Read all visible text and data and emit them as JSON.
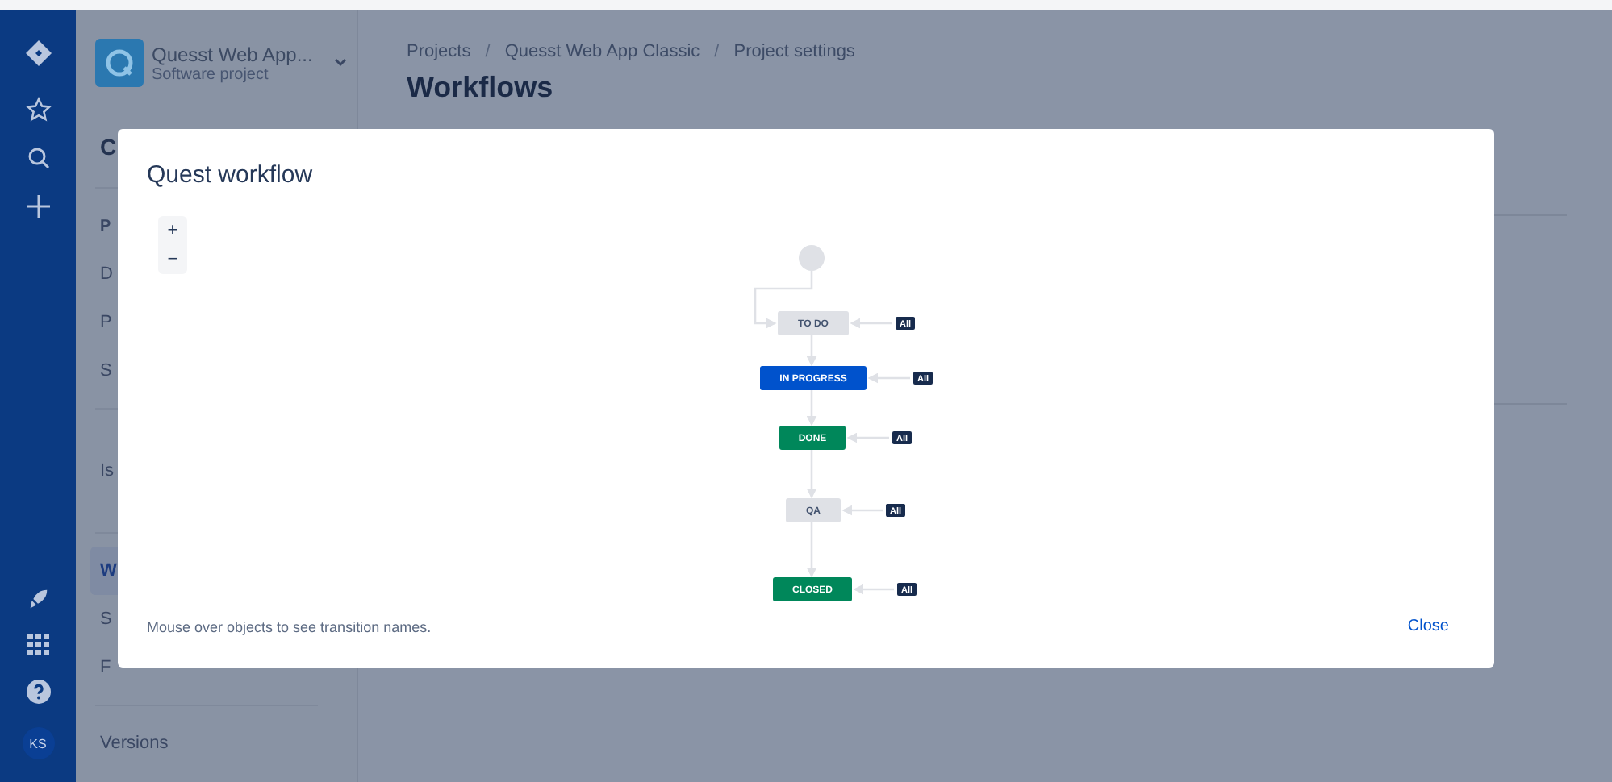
{
  "global_nav": {
    "avatar": "KS"
  },
  "project_sidebar": {
    "project_name": "Quesst Web App...",
    "project_type": "Software project",
    "heading": "C",
    "groups": [
      [
        {
          "label": "P",
          "kind": "heading",
          "selected": false
        },
        {
          "label": "D",
          "kind": "item",
          "selected": false
        },
        {
          "label": "P",
          "kind": "item",
          "selected": false
        },
        {
          "label": "S",
          "kind": "item",
          "selected": false
        }
      ],
      [
        {
          "label": "Is",
          "kind": "item",
          "selected": false
        }
      ],
      [
        {
          "label": "W",
          "kind": "item",
          "selected": true
        },
        {
          "label": "S",
          "kind": "item",
          "selected": false
        },
        {
          "label": "F",
          "kind": "item",
          "selected": false
        }
      ],
      [
        {
          "label": "Versions",
          "kind": "item",
          "selected": false
        }
      ]
    ]
  },
  "breadcrumbs": [
    {
      "kind": "link",
      "text": "Projects"
    },
    {
      "kind": "separator",
      "text": "/"
    },
    {
      "kind": "link",
      "text": "Quesst Web App Classic"
    },
    {
      "kind": "separator",
      "text": "/"
    },
    {
      "kind": "link",
      "text": "Project settings"
    }
  ],
  "page_title": "Workflows",
  "dialog": {
    "title": "Quest workflow",
    "zoom_in": "+",
    "zoom_out": "−",
    "statuses": [
      {
        "label": "TO DO",
        "color": "#dfe1e6",
        "badge": "All"
      },
      {
        "label": "IN PROGRESS",
        "color": "#0052cc",
        "badge": "All"
      },
      {
        "label": "DONE",
        "color": "#00875a",
        "badge": "All"
      },
      {
        "label": "QA",
        "color": "#dfe1e6",
        "badge": "All"
      },
      {
        "label": "CLOSED",
        "color": "#00875a",
        "badge": "All"
      }
    ],
    "hint": "Mouse over objects to see transition names.",
    "close": "Close"
  }
}
